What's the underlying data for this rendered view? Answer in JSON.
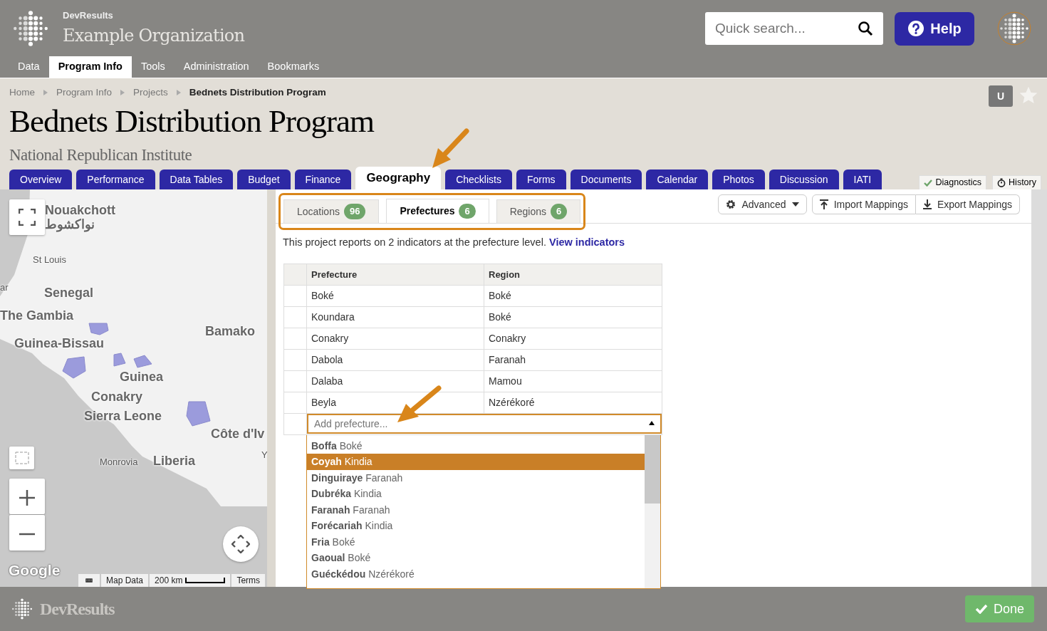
{
  "header": {
    "brand": "DevResults",
    "org": "Example Organization",
    "search": {
      "placeholder": "Quick search..."
    },
    "help": "Help"
  },
  "top_nav": [
    {
      "label": "Data",
      "selected": false
    },
    {
      "label": "Program Info",
      "selected": true
    },
    {
      "label": "Tools",
      "selected": false
    },
    {
      "label": "Administration",
      "selected": false
    },
    {
      "label": "Bookmarks",
      "selected": false
    }
  ],
  "breadcrumb": [
    "Home",
    "Program Info",
    "Projects",
    "Bednets Distribution Program"
  ],
  "user_badge": "U",
  "title": "Bednets Distribution Program",
  "subtitle": "National Republican Institute",
  "tabs": [
    {
      "label": "Overview",
      "selected": false
    },
    {
      "label": "Performance",
      "selected": false
    },
    {
      "label": "Data Tables",
      "selected": false
    },
    {
      "label": "Budget",
      "selected": false
    },
    {
      "label": "Finance",
      "selected": false
    },
    {
      "label": "Geography",
      "selected": true
    },
    {
      "label": "Checklists",
      "selected": false
    },
    {
      "label": "Forms",
      "selected": false
    },
    {
      "label": "Documents",
      "selected": false
    },
    {
      "label": "Calendar",
      "selected": false
    },
    {
      "label": "Photos",
      "selected": false
    },
    {
      "label": "Discussion",
      "selected": false
    },
    {
      "label": "IATI",
      "selected": false
    }
  ],
  "side_tabs": [
    {
      "label": "Diagnostics",
      "kind": "check"
    },
    {
      "label": "History",
      "kind": "timer"
    }
  ],
  "map": {
    "labels": [
      "Nouakchott",
      "نواكشوط",
      "St Louis",
      "ar",
      "Senegal",
      "The Gambia",
      "Guinea-Bissau",
      "Bamako",
      "Guinea",
      "Conakry",
      "Sierra Leone",
      "Côte d'Iv",
      "Y",
      "Monrovia",
      "Liberia"
    ],
    "logo": "Google",
    "attribution": [
      "Map Data",
      "200 km",
      "Terms"
    ]
  },
  "subtabs": [
    {
      "label": "Locations",
      "count": "96",
      "selected": false
    },
    {
      "label": "Prefectures",
      "count": "6",
      "selected": true
    },
    {
      "label": "Regions",
      "count": "6",
      "selected": false
    }
  ],
  "toolbar": {
    "advanced": "Advanced",
    "import": "Import Mappings",
    "export": "Export Mappings"
  },
  "intro": {
    "text": "This project reports on 2 indicators at the prefecture level.",
    "link": "View indicators"
  },
  "table": {
    "columns": [
      "Prefecture",
      "Region"
    ],
    "rows": [
      [
        "Boké",
        "Boké"
      ],
      [
        "Koundara",
        "Boké"
      ],
      [
        "Conakry",
        "Conakry"
      ],
      [
        "Dabola",
        "Faranah"
      ],
      [
        "Dalaba",
        "Mamou"
      ],
      [
        "Beyla",
        "Nzérékoré"
      ]
    ]
  },
  "add_select": {
    "placeholder": "Add prefecture...",
    "expanded": true
  },
  "options": [
    {
      "label": "**Boffa** Boké",
      "selected": false
    },
    {
      "label": "**Coyah** Kindia",
      "selected": true
    },
    {
      "label": "**Dinguiraye** Faranah",
      "selected": false
    },
    {
      "label": "**Dubréka** Kindia",
      "selected": false
    },
    {
      "label": "**Faranah** Faranah",
      "selected": false
    },
    {
      "label": "**Forécariah** Kindia",
      "selected": false
    },
    {
      "label": "**Fria** Boké",
      "selected": false
    },
    {
      "label": "**Gaoual** Boké",
      "selected": false
    },
    {
      "label": "**Guéckédou** Nzérékoré",
      "selected": false
    }
  ],
  "footer": {
    "brand": "DevResults",
    "done": "Done"
  }
}
